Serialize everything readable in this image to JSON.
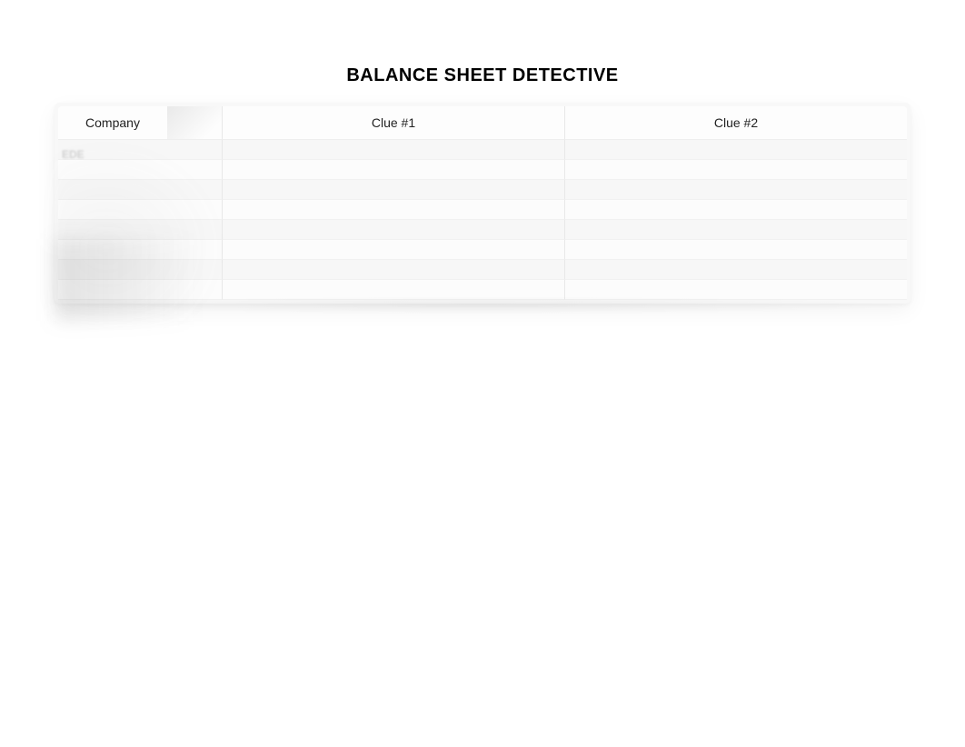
{
  "title": "BALANCE SHEET DETECTIVE",
  "obscured_label": "EDE",
  "table": {
    "headers": {
      "company": "Company",
      "num": "",
      "clue1": "Clue #1",
      "clue2": "Clue #2"
    },
    "rows": [
      {
        "company": "",
        "num": "",
        "clue1": "",
        "clue2": ""
      },
      {
        "company": "",
        "num": "",
        "clue1": "",
        "clue2": ""
      },
      {
        "company": "",
        "num": "",
        "clue1": "",
        "clue2": ""
      },
      {
        "company": "",
        "num": "",
        "clue1": "",
        "clue2": ""
      },
      {
        "company": "",
        "num": "",
        "clue1": "",
        "clue2": ""
      },
      {
        "company": "",
        "num": "",
        "clue1": "",
        "clue2": ""
      },
      {
        "company": "",
        "num": "",
        "clue1": "",
        "clue2": ""
      },
      {
        "company": "",
        "num": "",
        "clue1": "",
        "clue2": ""
      }
    ]
  }
}
